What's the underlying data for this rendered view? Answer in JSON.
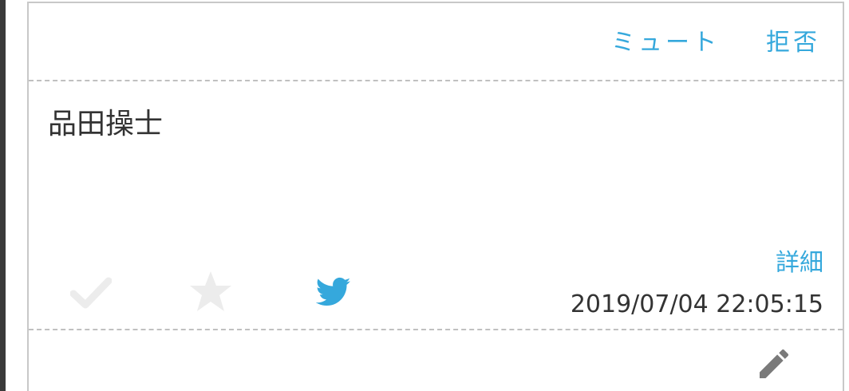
{
  "header": {
    "mute_label": "ミュート",
    "reject_label": "拒否"
  },
  "item": {
    "name": "品田操士",
    "detail_label": "詳細",
    "timestamp": "2019/07/04 22:05:15"
  },
  "icons": {
    "check": "check-icon",
    "star": "star-icon",
    "twitter": "twitter-bird-icon",
    "edit": "pencil-icon"
  },
  "colors": {
    "accent": "#35a8dc",
    "inactive_icon": "#ececec",
    "text": "#333333",
    "edit_icon": "#7a7a7a"
  }
}
